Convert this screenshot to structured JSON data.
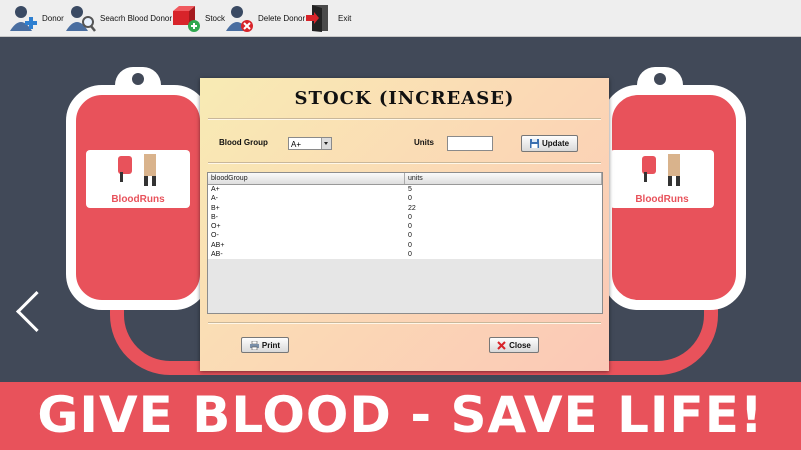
{
  "toolbar": {
    "items": [
      {
        "label": "Donor",
        "icon": "add-user-icon"
      },
      {
        "label": "Seacrh Blood Donor",
        "icon": "search-user-icon"
      },
      {
        "label": "Stock",
        "icon": "stock-add-icon"
      },
      {
        "label": "Delete Donor",
        "icon": "delete-user-icon"
      },
      {
        "label": "Exit",
        "icon": "exit-door-icon"
      }
    ]
  },
  "background": {
    "logo_text": "BloodRuns",
    "banner": "GIVE BLOOD - SAVE LIFE!",
    "colors": {
      "blood": "#e8525b",
      "dark": "#414958"
    }
  },
  "dialog": {
    "title": "STOCK (INCREASE)",
    "blood_group_label": "Blood Group",
    "blood_group_value": "A+",
    "units_label": "Units",
    "units_value": "",
    "update_label": "Update",
    "print_label": "Print",
    "close_label": "Close",
    "table": {
      "columns": [
        "bloodGroup",
        "units"
      ],
      "rows": [
        [
          "A+",
          "5"
        ],
        [
          "A-",
          "0"
        ],
        [
          "B+",
          "22"
        ],
        [
          "B-",
          "0"
        ],
        [
          "O+",
          "0"
        ],
        [
          "O-",
          "0"
        ],
        [
          "AB+",
          "0"
        ],
        [
          "AB-",
          "0"
        ]
      ]
    }
  }
}
